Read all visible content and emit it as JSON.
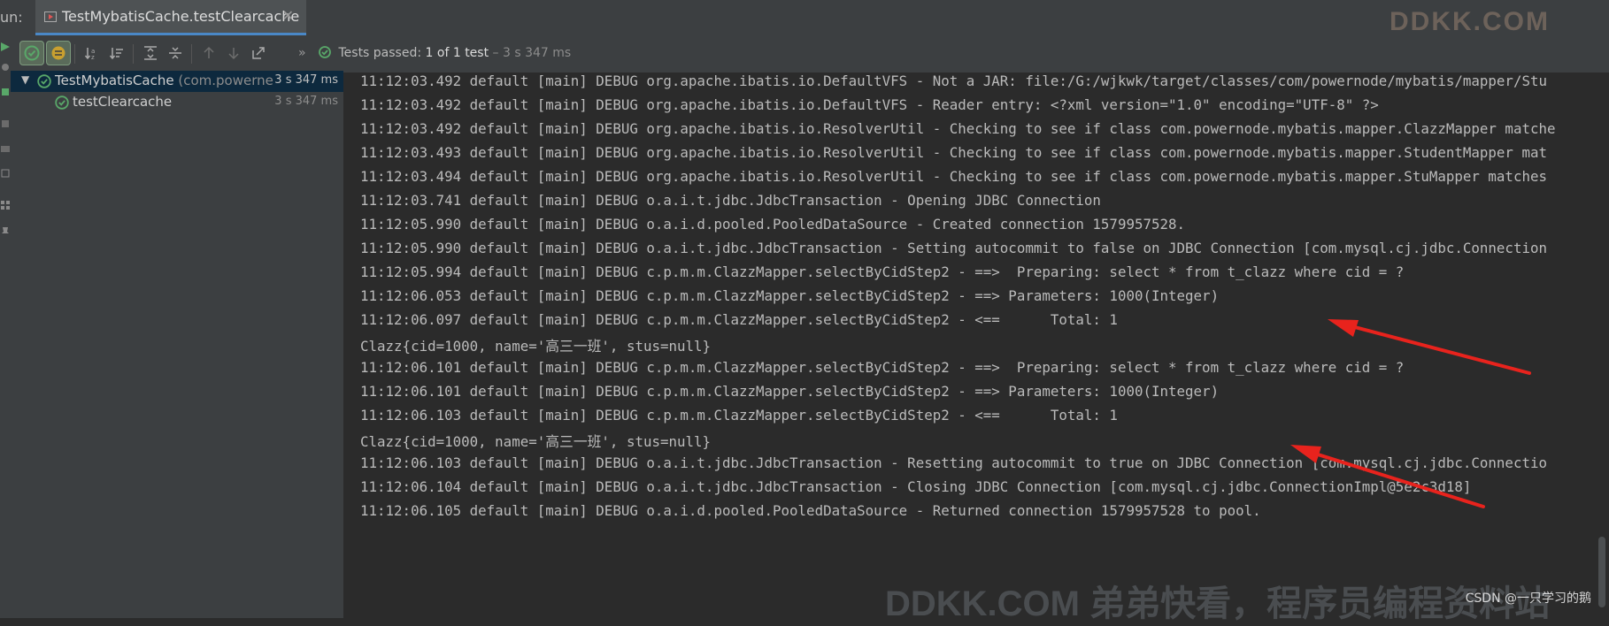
{
  "run_label": "un:",
  "tab": {
    "title": "TestMybatisCache.testClearcache"
  },
  "status": {
    "prefix": "Tests passed:",
    "count": "1 of 1 test",
    "duration": "– 3 s 347 ms"
  },
  "tree": [
    {
      "name": "TestMybatisCache",
      "pkg": " (com.powerne",
      "time": "3 s 347 ms"
    },
    {
      "name": "testClearcache",
      "time": "3 s 347 ms"
    }
  ],
  "console_lines": [
    "11:12:03.492 default [main] DEBUG org.apache.ibatis.io.DefaultVFS - Not a JAR: file:/G:/wjkwk/target/classes/com/powernode/mybatis/mapper/Stu",
    "11:12:03.492 default [main] DEBUG org.apache.ibatis.io.DefaultVFS - Reader entry: <?xml version=\"1.0\" encoding=\"UTF-8\" ?>",
    "11:12:03.492 default [main] DEBUG org.apache.ibatis.io.ResolverUtil - Checking to see if class com.powernode.mybatis.mapper.ClazzMapper matche",
    "11:12:03.493 default [main] DEBUG org.apache.ibatis.io.ResolverUtil - Checking to see if class com.powernode.mybatis.mapper.StudentMapper mat",
    "11:12:03.494 default [main] DEBUG org.apache.ibatis.io.ResolverUtil - Checking to see if class com.powernode.mybatis.mapper.StuMapper matches",
    "11:12:03.741 default [main] DEBUG o.a.i.t.jdbc.JdbcTransaction - Opening JDBC Connection",
    "11:12:05.990 default [main] DEBUG o.a.i.d.pooled.PooledDataSource - Created connection 1579957528.",
    "11:12:05.990 default [main] DEBUG o.a.i.t.jdbc.JdbcTransaction - Setting autocommit to false on JDBC Connection [com.mysql.cj.jdbc.Connection",
    "11:12:05.994 default [main] DEBUG c.p.m.m.ClazzMapper.selectByCidStep2 - ==>  Preparing: select * from t_clazz where cid = ?",
    "11:12:06.053 default [main] DEBUG c.p.m.m.ClazzMapper.selectByCidStep2 - ==> Parameters: 1000(Integer)",
    "11:12:06.097 default [main] DEBUG c.p.m.m.ClazzMapper.selectByCidStep2 - <==      Total: 1",
    "Clazz{cid=1000, name='高三一班', stus=null}",
    "11:12:06.101 default [main] DEBUG c.p.m.m.ClazzMapper.selectByCidStep2 - ==>  Preparing: select * from t_clazz where cid = ?",
    "11:12:06.101 default [main] DEBUG c.p.m.m.ClazzMapper.selectByCidStep2 - ==> Parameters: 1000(Integer)",
    "11:12:06.103 default [main] DEBUG c.p.m.m.ClazzMapper.selectByCidStep2 - <==      Total: 1",
    "Clazz{cid=1000, name='高三一班', stus=null}",
    "11:12:06.103 default [main] DEBUG o.a.i.t.jdbc.JdbcTransaction - Resetting autocommit to true on JDBC Connection [com.mysql.cj.jdbc.Connectio",
    "11:12:06.104 default [main] DEBUG o.a.i.t.jdbc.JdbcTransaction - Closing JDBC Connection [com.mysql.cj.jdbc.ConnectionImpl@5e2c3d18]",
    "11:12:06.105 default [main] DEBUG o.a.i.d.pooled.PooledDataSource - Returned connection 1579957528 to pool."
  ],
  "watermark": "DDKK.COM 弟弟快看，程序员编程资料站",
  "brand": "DDKK.COM",
  "csdn": "CSDN @一只学习的鹅",
  "colors": {
    "pass": "#59a869",
    "selection": "#0d293e",
    "arrow": "#e8231d",
    "accent": "#4a88c7"
  }
}
